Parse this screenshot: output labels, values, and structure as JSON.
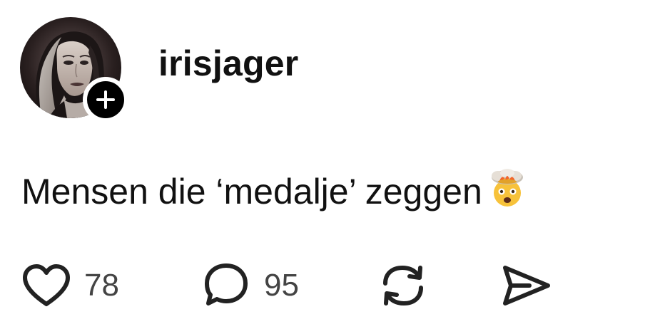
{
  "post": {
    "author": {
      "username": "irisjager"
    },
    "text": "Mensen die ‘medalje’ zeggen",
    "emoji": "exploding-head",
    "actions": {
      "likes": "78",
      "replies": "95"
    }
  },
  "icons": {
    "follow": "plus-icon",
    "like": "heart-icon",
    "reply": "speech-bubble-icon",
    "repost": "repost-icon",
    "share": "send-icon"
  },
  "colors": {
    "text": "#111111",
    "count": "#444444",
    "follow_badge": "#000000"
  }
}
